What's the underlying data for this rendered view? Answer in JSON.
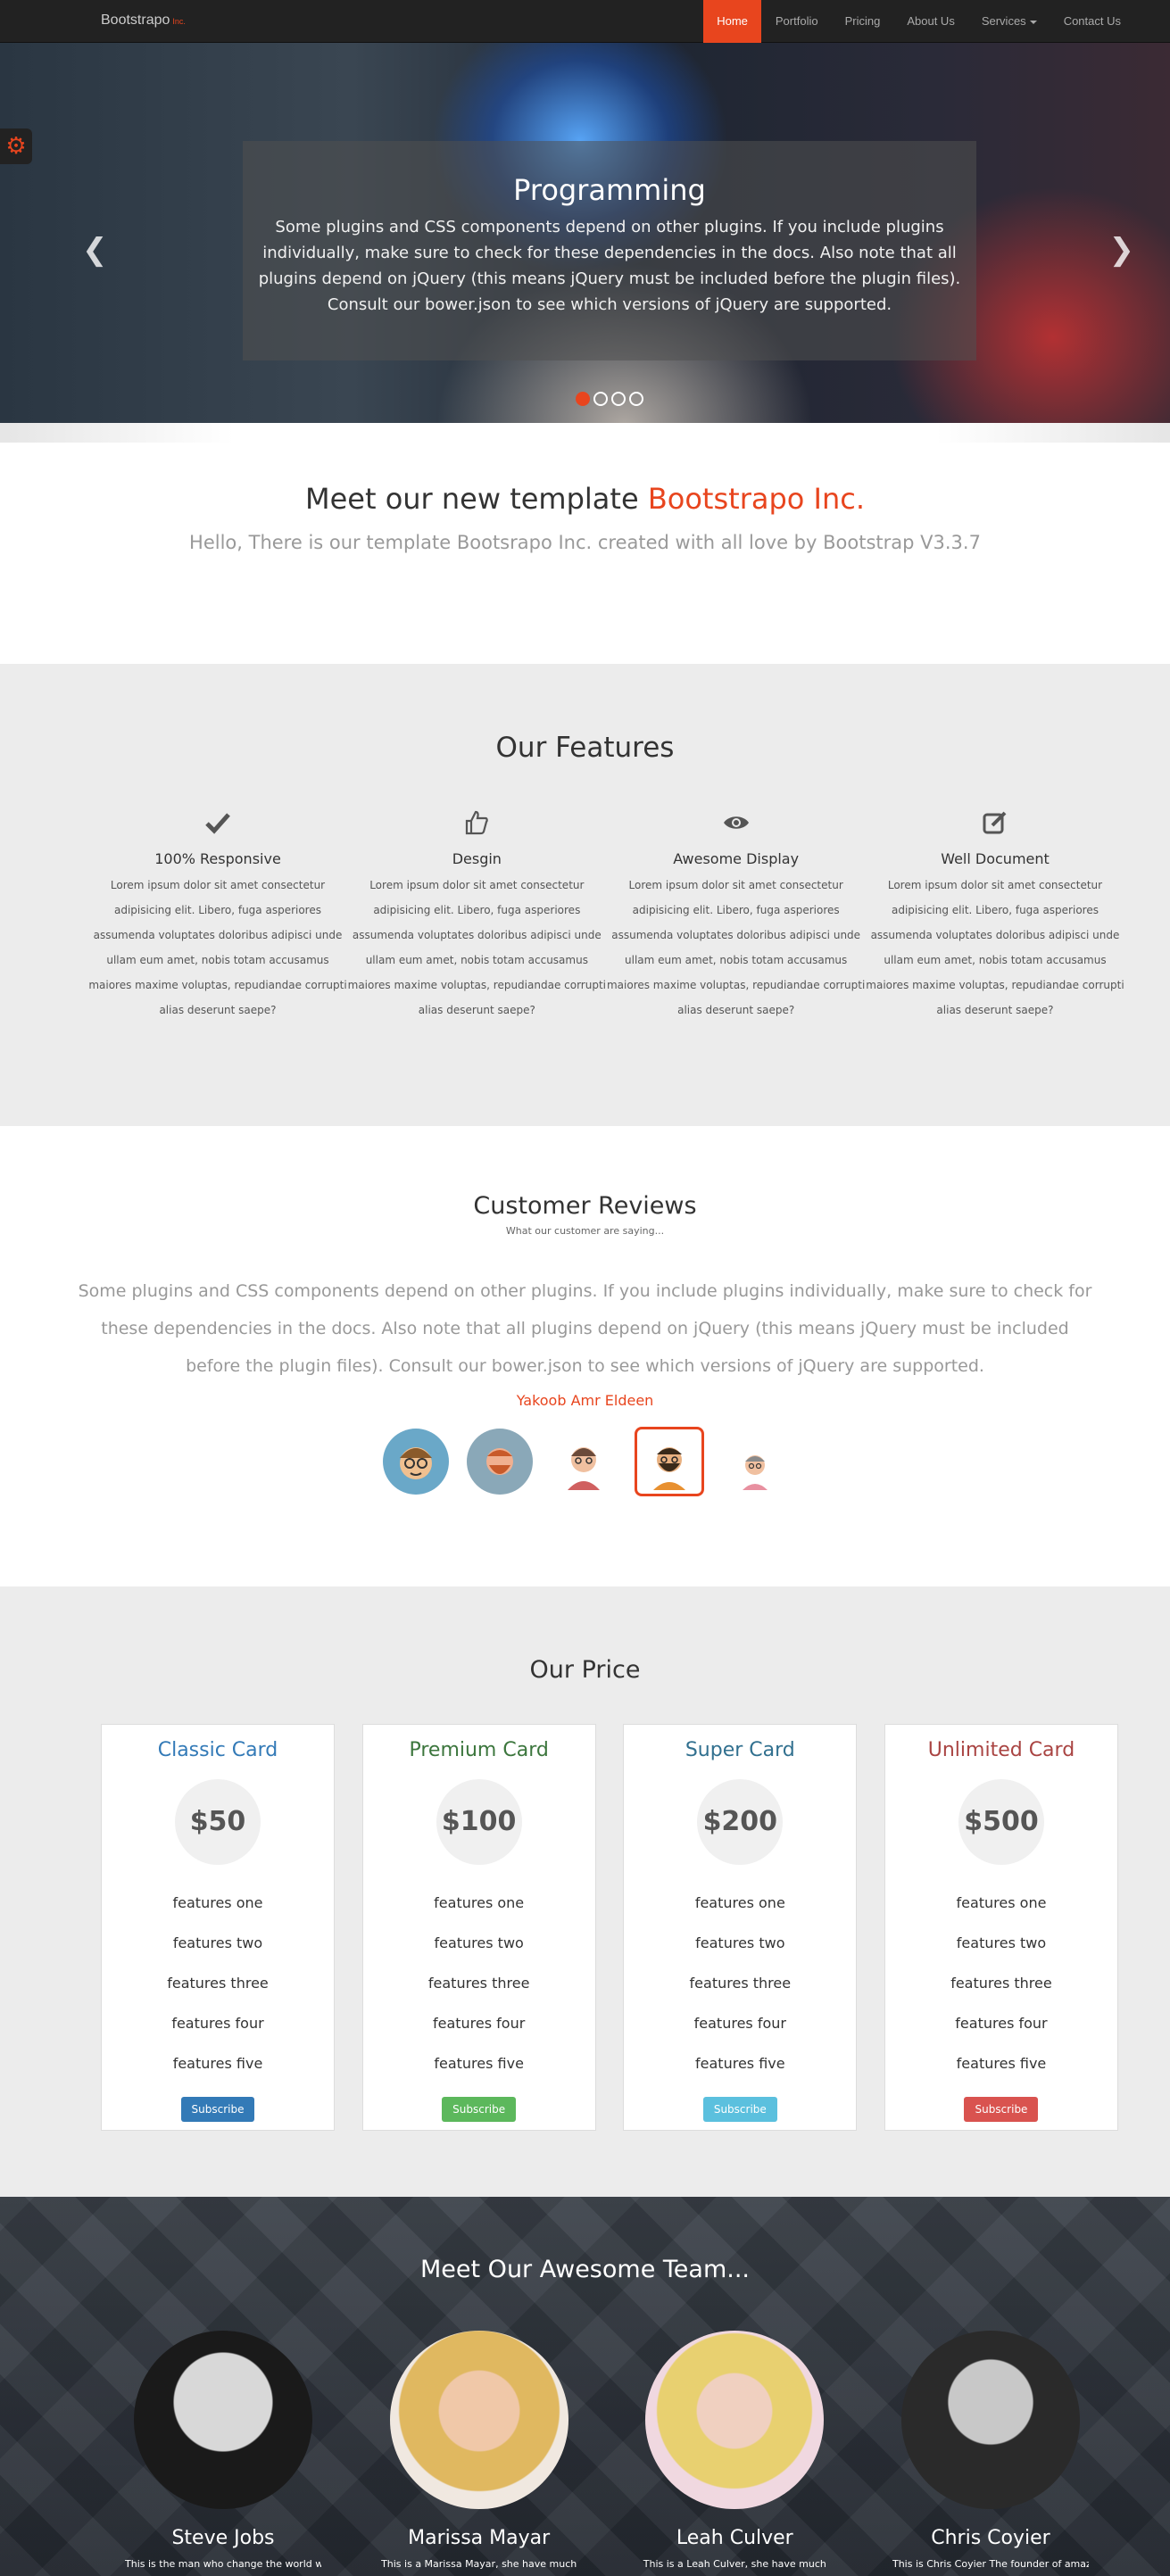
{
  "navbar": {
    "brand": "Bootstrapo",
    "brand_suffix": "Inc.",
    "items": [
      {
        "label": "Home",
        "active": true
      },
      {
        "label": "Portfolio"
      },
      {
        "label": "Pricing"
      },
      {
        "label": "About Us"
      },
      {
        "label": "Services"
      },
      {
        "label": "Contact Us"
      }
    ]
  },
  "hero": {
    "title": "Programming",
    "text": "Some plugins and CSS components depend on other plugins. If you include plugins individually, make sure to check for these dependencies in the docs. Also note that all plugins depend on jQuery (this means jQuery must be included before the plugin files). Consult our bower.json to see which versions of jQuery are supported.",
    "prev_icon": "chevron-left-icon",
    "next_icon": "chevron-right-icon",
    "slide_count": 4,
    "active_slide": 1
  },
  "intro": {
    "title": "Meet our new template",
    "title_accent": "Bootstrapo Inc.",
    "subtitle": "Hello, There is our template Bootsrapo Inc. created with all love by Bootstrap V3.3.7"
  },
  "features": {
    "title": "Our Features",
    "items": [
      {
        "icon": "check-icon",
        "title": "100% Responsive",
        "text": "Lorem ipsum dolor sit amet consectetur adipisicing elit. Libero, fuga asperiores assumenda voluptates doloribus adipisci unde ullam eum amet, nobis totam accusamus maiores maxime voluptas, repudiandae corrupti alias deserunt saepe?"
      },
      {
        "icon": "thumbs-up-icon",
        "title": "Desgin",
        "text": "Lorem ipsum dolor sit amet consectetur adipisicing elit. Libero, fuga asperiores assumenda voluptates doloribus adipisci unde ullam eum amet, nobis totam accusamus maiores maxime voluptas, repudiandae corrupti alias deserunt saepe?"
      },
      {
        "icon": "eye-icon",
        "title": "Awesome Display",
        "text": "Lorem ipsum dolor sit amet consectetur adipisicing elit. Libero, fuga asperiores assumenda voluptates doloribus adipisci unde ullam eum amet, nobis totam accusamus maiores maxime voluptas, repudiandae corrupti alias deserunt saepe?"
      },
      {
        "icon": "edit-icon",
        "title": "Well Document",
        "text": "Lorem ipsum dolor sit amet consectetur adipisicing elit. Libero, fuga asperiores assumenda voluptates doloribus adipisci unde ullam eum amet, nobis totam accusamus maiores maxime voluptas, repudiandae corrupti alias deserunt saepe?"
      }
    ]
  },
  "reviews": {
    "title": "Customer Reviews",
    "subtitle": "What our customer are saying...",
    "text": "Some plugins and CSS components depend on other plugins. If you include plugins individually, make sure to check for these dependencies in the docs. Also note that all plugins depend on jQuery (this means jQuery must be included before the plugin files). Consult our bower.json to see which versions of jQuery are supported.",
    "author": "Yakoob Amr Eldeen",
    "avatars": [
      "avatar-1",
      "avatar-2",
      "avatar-3",
      "avatar-4",
      "avatar-5"
    ],
    "active_avatar": 4
  },
  "price": {
    "title": "Our Price",
    "cards": [
      {
        "title": "Classic Card",
        "price": "$50",
        "color": "#337ab7",
        "btn_color": "#337ab7",
        "features": [
          "features one",
          "features two",
          "features three",
          "features four",
          "features five"
        ],
        "button": "Subscribe"
      },
      {
        "title": "Premium Card",
        "price": "$100",
        "color": "#3c763d",
        "btn_color": "#5cb85c",
        "features": [
          "features one",
          "features two",
          "features three",
          "features four",
          "features five"
        ],
        "button": "Subscribe"
      },
      {
        "title": "Super Card",
        "price": "$200",
        "color": "#31708f",
        "btn_color": "#5bc0de",
        "features": [
          "features one",
          "features two",
          "features three",
          "features four",
          "features five"
        ],
        "button": "Subscribe"
      },
      {
        "title": "Unlimited Card",
        "price": "$500",
        "color": "#a94442",
        "btn_color": "#d9534f",
        "features": [
          "features one",
          "features two",
          "features three",
          "features four",
          "features five"
        ],
        "button": "Subscribe"
      }
    ]
  },
  "team": {
    "title": "Meet Our Awesome Team...",
    "members": [
      {
        "name": "Steve Jobs",
        "bio": "This is the man who change the world with his"
      },
      {
        "name": "Marissa Mayar",
        "bio": "This is a Marissa Mayar, she have much"
      },
      {
        "name": "Leah Culver",
        "bio": "This is a Leah Culver, she have much"
      },
      {
        "name": "Chris Coyier",
        "bio": "This is Chris Coyier The founder of amazing"
      }
    ]
  },
  "colors": {
    "accent": "#e8451e",
    "nav_bg": "#222222",
    "section_bg": "#ececec"
  }
}
